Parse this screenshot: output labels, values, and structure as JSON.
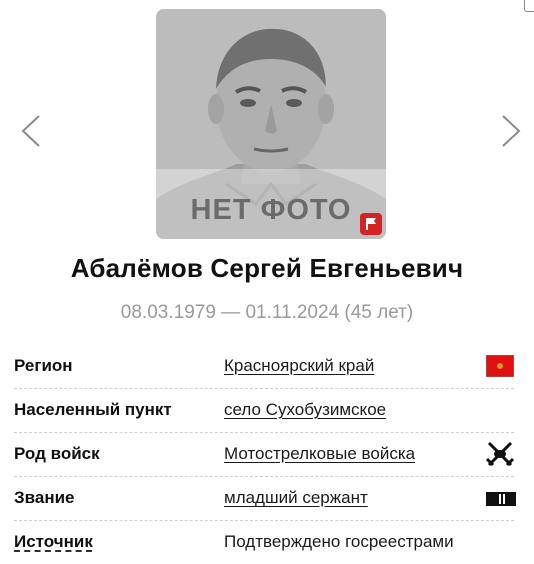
{
  "photo": {
    "placeholder_text": "НЕТ ФОТО",
    "badge_color": "#d32323",
    "icon": "flag-icon"
  },
  "nav": {
    "prev_icon": "chevron-left-icon",
    "next_icon": "chevron-right-icon"
  },
  "person": {
    "name": "Абалёмов Сергей Евгеньевич",
    "dates": "08.03.1979 — 01.11.2024 (45 лет)"
  },
  "info": [
    {
      "label": "Регион",
      "value": "Красноярский край",
      "link": true,
      "icon": "region-flag-icon"
    },
    {
      "label": "Населенный пункт",
      "value": "село Сухобузимское",
      "link": true,
      "icon": ""
    },
    {
      "label": "Род войск",
      "value": "Мотострелковые войска",
      "link": true,
      "icon": "motorized-rifle-emblem-icon"
    },
    {
      "label": "Звание",
      "value": "младший сержант",
      "link": true,
      "icon": "rank-insignia-icon"
    },
    {
      "label": "Источник",
      "value": "Подтверждено госреестрами",
      "link": false,
      "icon": ""
    }
  ],
  "colors": {
    "region_flag": "#e01010",
    "dates_text": "#9a9a9a"
  }
}
